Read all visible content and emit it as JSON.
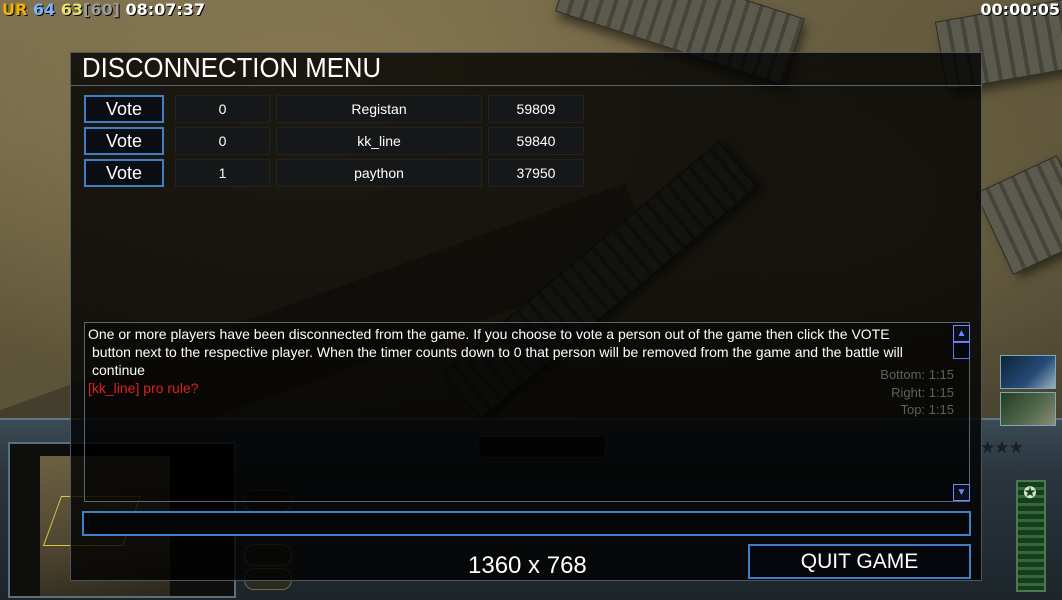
{
  "hud": {
    "ur_label": "UR",
    "fps_current": "64",
    "fps_avg": "63",
    "fps_cap": "[60]",
    "clock": "08:07:37",
    "game_timer": "00:00:05"
  },
  "dialog": {
    "title": "DISCONNECTION MENU",
    "players": [
      {
        "vote_label": "Vote",
        "votes": "0",
        "name": "Registan",
        "ping": "59809"
      },
      {
        "vote_label": "Vote",
        "votes": "0",
        "name": "kk_line",
        "ping": "59840"
      },
      {
        "vote_label": "Vote",
        "votes": "1",
        "name": "paython",
        "ping": "37950"
      }
    ],
    "chat": {
      "system_line1": "One or more players have been disconnected from the game. If you choose to vote a person out of the game then click the VOTE",
      "system_line2": "button next to the respective player. When the timer counts down to 0 that person will be removed from the game and the battle will",
      "system_line3": "continue",
      "player_message": "[kk_line] pro rule?",
      "background_labels": [
        "Bottom: 1:15",
        "Right: 1:15",
        "Top: 1:15"
      ]
    },
    "chat_input_value": "",
    "resolution": "1360 x 768",
    "quit_label": "QUIT GAME"
  },
  "colors": {
    "accent_blue": "#3e7fc8",
    "scrollbar_blue": "#6f88ff",
    "chat_red": "#e02020",
    "hud_yellow": "#f2b400"
  },
  "icons": {
    "scroll_up": "triangle-up-icon",
    "scroll_down": "triangle-down-icon",
    "rank_stars": "star-icon",
    "side_star": "star-icon"
  }
}
